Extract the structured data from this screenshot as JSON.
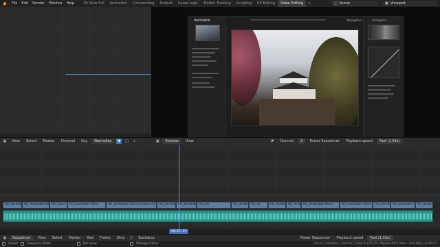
{
  "topbar": {
    "menu": [
      "File",
      "Edit",
      "Render",
      "Window",
      "Help"
    ],
    "workspaces": [
      "3D View Full",
      "Animation",
      "Compositing",
      "Default",
      "Game Logic",
      "Motion Tracking",
      "Scripting",
      "UV Editing",
      "Video Editing"
    ],
    "active_workspace": "Video Editing",
    "add_tab": "+",
    "scene_label": "Scene",
    "view_layer_label": "Viewport"
  },
  "darktable": {
    "app_title": "darktable",
    "histogram_label": "histogram",
    "module_label": "Navigation"
  },
  "sequencer_header": {
    "menus": [
      "View",
      "Select",
      "Marker",
      "Channel",
      "Key"
    ],
    "normalize_label": "Normalize",
    "preview_label": "Preview",
    "view_label": "View",
    "channel_label": "Channel",
    "channel_value": "0",
    "power_sequencer_label": "Power Sequencer",
    "playback_speed_label": "Playback speed",
    "fast_label": "Fast (1.33x)"
  },
  "strips": [
    {
      "label": "00_darktable-"
    },
    {
      "label": "00_darktable-films-"
    },
    {
      "label": "00_darkt"
    },
    {
      "label": "00_darktable-films-"
    },
    {
      "label": "00_darktable-films-module-037-"
    },
    {
      "label": "00_darktable-fil"
    },
    {
      "label": "00_darktable-films-mod"
    },
    {
      "label": "00_dar"
    },
    {
      "label": "00_darktable-films-"
    },
    {
      "label": "00_da"
    },
    {
      "label": "00_darktable-fi"
    },
    {
      "label": "00_dark"
    },
    {
      "label": "00_darktable-films-"
    },
    {
      "label": "00_darktable-films-m"
    },
    {
      "label": "00_darkta"
    },
    {
      "label": "00_darktable-films"
    },
    {
      "label": "00_darkta"
    }
  ],
  "playhead": {
    "frame_label": "00:39+03"
  },
  "sequencer_footer": {
    "editor_label": "Sequencer",
    "menus": [
      "View",
      "Select",
      "Marker",
      "Add",
      "Frame",
      "Strip"
    ],
    "backdrop_label": "Backdrop",
    "power_sequencer_label": "Power Sequencer",
    "playback_speed_label": "Playback speed",
    "fast_label": "Fast (1.33x)"
  },
  "statusbar": {
    "select": "Select",
    "sequence_slide": "Sequence Slide",
    "pan_view": "Pan View",
    "change_frame": "Change Frame",
    "stats": "Scene Collection | Verts:0 | Faces:0 | Tris:0 | Objects:0/0 | Mem: 22.8 MiB | v2.80.47"
  },
  "colors": {
    "accent": "#4772b3",
    "video_strip": "#5d7ea1",
    "audio_strip": "#2f8c86"
  }
}
